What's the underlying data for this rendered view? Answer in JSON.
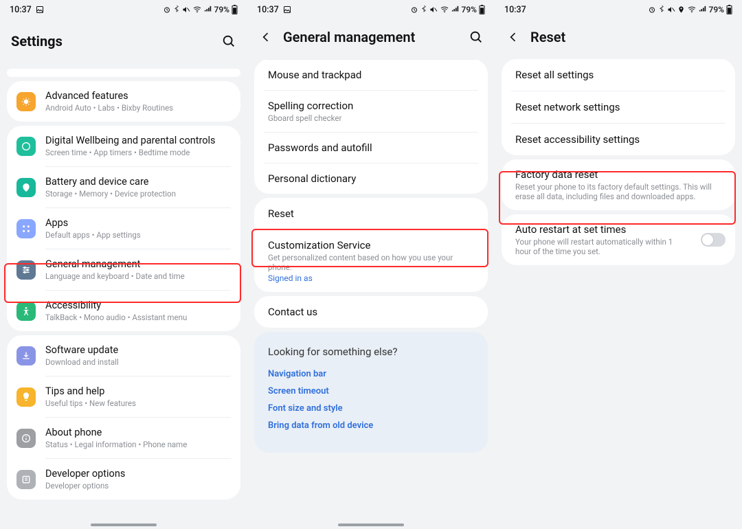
{
  "status": {
    "time": "10:37",
    "battery_text": "79%",
    "left_icons": [
      "p"
    ],
    "right_icons": [
      "alarm",
      "bluetooth",
      "mute",
      "wifi",
      "signal",
      "battery"
    ]
  },
  "screen1": {
    "title": "Settings",
    "items": [
      {
        "title": "Advanced features",
        "sub": "Android Auto  •  Labs  •  Bixby Routines",
        "icon_bg": "#f6a52e",
        "icon": "advanced"
      },
      {
        "title": "Digital Wellbeing and parental controls",
        "sub": "Screen time  •  App timers  •  Bedtime mode",
        "icon_bg": "#1fbf9c",
        "icon": "wellbeing"
      },
      {
        "title": "Battery and device care",
        "sub": "Storage  •  Memory  •  Device protection",
        "icon_bg": "#18b89b",
        "icon": "battery"
      },
      {
        "title": "Apps",
        "sub": "Default apps  •  App settings",
        "icon_bg": "#8aa7ff",
        "icon": "apps"
      },
      {
        "title": "General management",
        "sub": "Language and keyboard  •  Date and time",
        "icon_bg": "#5f7894",
        "icon": "general"
      },
      {
        "title": "Accessibility",
        "sub": "TalkBack  •  Mono audio  •  Assistant menu",
        "icon_bg": "#2ab978",
        "icon": "accessibility"
      },
      {
        "title": "Software update",
        "sub": "Download and install",
        "icon_bg": "#8a94e6",
        "icon": "update"
      },
      {
        "title": "Tips and help",
        "sub": "Useful tips  •  New features",
        "icon_bg": "#f7b42c",
        "icon": "tips"
      },
      {
        "title": "About phone",
        "sub": "Status  •  Legal information  •  Phone name",
        "icon_bg": "#9d9fa2",
        "icon": "about"
      },
      {
        "title": "Developer options",
        "sub": "Developer options",
        "icon_bg": "#aeb1b5",
        "icon": "dev"
      }
    ]
  },
  "screen2": {
    "title": "General management",
    "group1": [
      {
        "title": "Mouse and trackpad"
      },
      {
        "title": "Spelling correction",
        "sub": "Gboard spell checker"
      },
      {
        "title": "Passwords and autofill"
      },
      {
        "title": "Personal dictionary"
      }
    ],
    "reset_title": "Reset",
    "cust": {
      "title": "Customization Service",
      "sub": "Get personalized content based on how you use your phone.",
      "link": "Signed in as"
    },
    "contact_title": "Contact us",
    "looking": {
      "ask": "Looking for something else?",
      "links": [
        "Navigation bar",
        "Screen timeout",
        "Font size and style",
        "Bring data from old device"
      ]
    }
  },
  "screen3": {
    "title": "Reset",
    "group1": [
      {
        "title": "Reset all settings"
      },
      {
        "title": "Reset network settings"
      },
      {
        "title": "Reset accessibility settings"
      }
    ],
    "factory": {
      "title": "Factory data reset",
      "sub": "Reset your phone to its factory default settings. This will erase all data, including files and downloaded apps."
    },
    "auto": {
      "title": "Auto restart at set times",
      "sub": "Your phone will restart automatically within 1 hour of the time you set."
    }
  }
}
